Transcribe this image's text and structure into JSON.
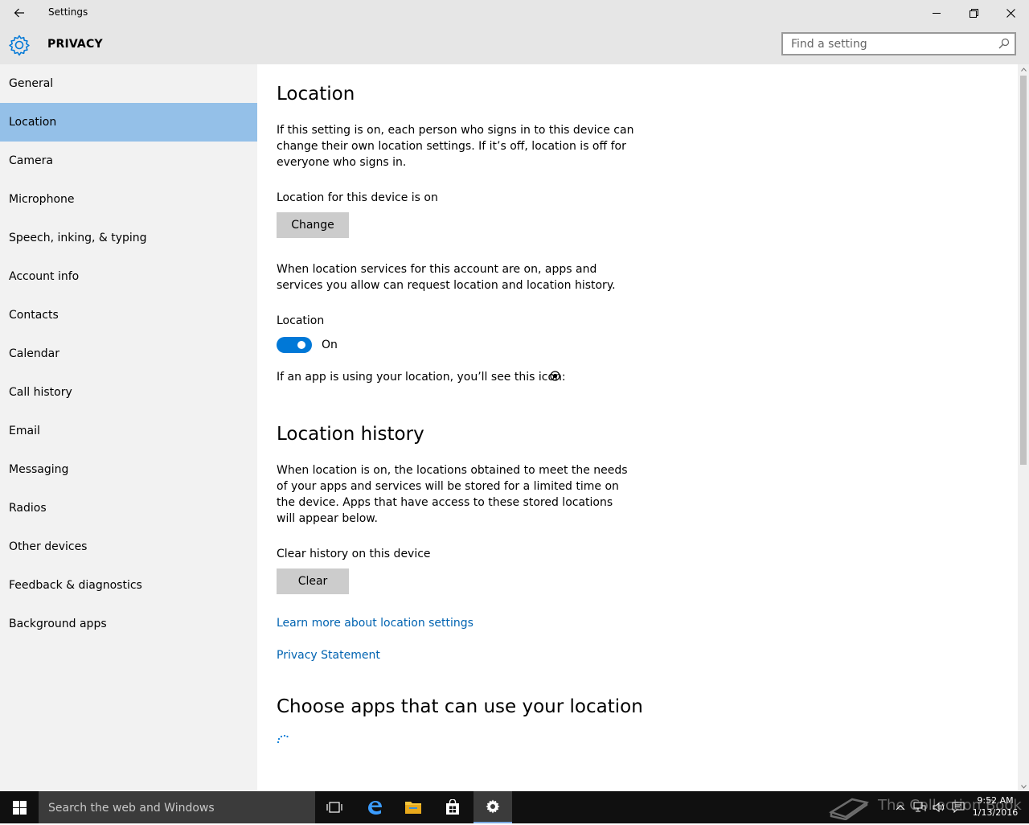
{
  "window": {
    "title": "Settings"
  },
  "header": {
    "title": "PRIVACY",
    "search_placeholder": "Find a setting"
  },
  "sidebar": {
    "items": [
      {
        "label": "General"
      },
      {
        "label": "Location"
      },
      {
        "label": "Camera"
      },
      {
        "label": "Microphone"
      },
      {
        "label": "Speech, inking, & typing"
      },
      {
        "label": "Account info"
      },
      {
        "label": "Contacts"
      },
      {
        "label": "Calendar"
      },
      {
        "label": "Call history"
      },
      {
        "label": "Email"
      },
      {
        "label": "Messaging"
      },
      {
        "label": "Radios"
      },
      {
        "label": "Other devices"
      },
      {
        "label": "Feedback & diagnostics"
      },
      {
        "label": "Background apps"
      }
    ],
    "selected": "Location"
  },
  "content": {
    "location": {
      "heading": "Location",
      "description": "If this setting is on, each person who signs in to this device can change their own location settings. If it’s off, location is off for everyone who signs in.",
      "device_status": "Location for this device is on",
      "change_button": "Change",
      "account_description": "When location services for this account are on, apps and services you allow can request location and location history.",
      "toggle_label": "Location",
      "toggle_state": "On",
      "icon_note": "If an app is using your location, you’ll see this icon:"
    },
    "history": {
      "heading": "Location history",
      "description": "When location is on, the locations obtained to meet the needs of your apps and services will be stored for a limited time on the device. Apps that have access to these stored locations will appear below.",
      "clear_label": "Clear history on this device",
      "clear_button": "Clear"
    },
    "links": {
      "learn_more": "Learn more about location settings",
      "privacy": "Privacy Statement"
    },
    "apps": {
      "heading": "Choose apps that can use your location"
    }
  },
  "taskbar": {
    "search_placeholder": "Search the web and Windows",
    "clock_time": "9:52 AM",
    "clock_date": "1/13/2016",
    "watermark": "The Collection Book"
  },
  "colors": {
    "accent": "#0078d7",
    "link": "#0063b1",
    "selected_nav": "#94c0e8",
    "sidebar_bg": "#f2f2f2",
    "chrome_bg": "#e6e6e6",
    "taskbar_bg": "#101010"
  }
}
